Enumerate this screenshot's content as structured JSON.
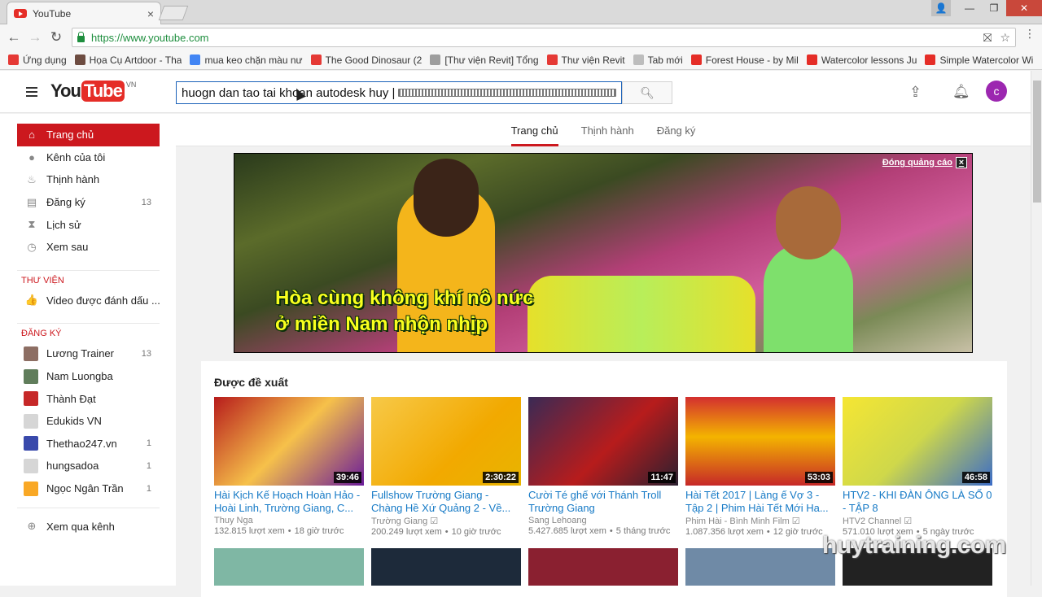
{
  "browser": {
    "tab_title": "YouTube",
    "tab_close": "×",
    "url": "https://www.youtube.com",
    "bookmarks": [
      {
        "label": "Ứng dụng",
        "color": "#e53935"
      },
      {
        "label": "Họa Cụ Artdoor - Tha",
        "color": "#6d4c41"
      },
      {
        "label": "mua keo chặn màu nư",
        "color": "#4285f4"
      },
      {
        "label": "The Good Dinosaur (2",
        "color": "#e53935"
      },
      {
        "label": "[Thư viện Revit] Tổng",
        "color": "#9e9e9e"
      },
      {
        "label": "Thư viện Revit",
        "color": "#e53935"
      },
      {
        "label": "Tab mới",
        "color": "#bdbdbd"
      },
      {
        "label": "Forest House - by Mil",
        "color": "#e52d27"
      },
      {
        "label": "Watercolor lessons Ju",
        "color": "#e52d27"
      },
      {
        "label": "Simple Watercolor Wi",
        "color": "#e52d27"
      }
    ]
  },
  "header": {
    "logo_you": "You",
    "logo_tube": "Tube",
    "logo_region": "VN",
    "search_value": "huogn dan tao tai khoan autodesk huy |",
    "avatar_letter": "c"
  },
  "sidebar": {
    "main_items": [
      {
        "label": "Trang chủ",
        "icon": "⌂",
        "active": true
      },
      {
        "label": "Kênh của tôi",
        "icon": "●"
      },
      {
        "label": "Thịnh hành",
        "icon": "♨"
      },
      {
        "label": "Đăng ký",
        "icon": "▤",
        "count": "13"
      },
      {
        "label": "Lịch sử",
        "icon": "⧗"
      },
      {
        "label": "Xem sau",
        "icon": "◷"
      }
    ],
    "library_heading": "THƯ VIỆN",
    "library_items": [
      {
        "label": "Video được đánh dấu ...",
        "icon": "👍"
      }
    ],
    "subs_heading": "ĐĂNG KÝ",
    "subscriptions": [
      {
        "label": "Lương Trainer",
        "count": "13",
        "color": "#8d6e63"
      },
      {
        "label": "Nam Luongba",
        "count": "",
        "color": "#607d5b"
      },
      {
        "label": "Thành Đạt",
        "count": "",
        "color": "#c62828"
      },
      {
        "label": "Edukids VN",
        "count": "",
        "color": "#d6d6d6"
      },
      {
        "label": "Thethao247.vn",
        "count": "1",
        "color": "#3949ab"
      },
      {
        "label": "hungsadoa",
        "count": "1",
        "color": "#d6d6d6"
      },
      {
        "label": "Ngọc Ngân Trần",
        "count": "1",
        "color": "#f9a825"
      }
    ],
    "browse_channels": "Xem qua kênh"
  },
  "tabs": [
    "Trang chủ",
    "Thịnh hành",
    "Đăng ký"
  ],
  "ad": {
    "caption_line1": "Hòa cùng không khí nô nức",
    "caption_line2": "ở miền Nam nhộn nhịp",
    "close_label": "Đóng quảng cáo",
    "close_x": "×"
  },
  "recommended": {
    "heading": "Được đề xuất",
    "videos": [
      {
        "title": "Hài Kịch Kế Hoạch Hoàn Hảo - Hoài Linh, Trường Giang, C...",
        "channel": "Thuy Nga",
        "views": "132.815 lượt xem",
        "age": "18 giờ trước",
        "duration": "39:46",
        "bg": "linear-gradient(135deg,#b71c1c,#f6c14a 50%,#6a1b9a)"
      },
      {
        "title": "Fullshow Trường Giang - Chàng Hề Xứ Quảng 2 - Về...",
        "channel": "Trường Giang ☑",
        "views": "200.249 lượt xem",
        "age": "10 giờ trước",
        "duration": "2:30:22",
        "bg": "linear-gradient(135deg,#f7c948,#f2a900 60%,#e8b400)"
      },
      {
        "title": "Cười Té ghế với Thánh Troll Trường Giang",
        "channel": "Sang Lehoang",
        "views": "5.427.685 lượt xem",
        "age": "5 tháng trước",
        "duration": "11:47",
        "bg": "linear-gradient(135deg,#3a2a55,#b71c1c 55%,#2b2030)"
      },
      {
        "title": "Hài Tết 2017 | Làng ế Vợ 3 - Tập 2 | Phim Hài Tết Mới Ha...",
        "channel": "Phim Hài - Bình Minh Film ☑",
        "views": "1.087.356 lượt xem",
        "age": "12 giờ trước",
        "duration": "53:03",
        "bg": "linear-gradient(180deg,#d32f2f,#f4b400 45%,#c62828)"
      },
      {
        "title": "HTV2 - KHI ĐÀN ÔNG LÀ SỐ 0 - TẬP 8",
        "channel": "HTV2 Channel ☑",
        "views": "571.010 lượt xem",
        "age": "5 ngày trước",
        "duration": "46:58",
        "bg": "linear-gradient(135deg,#f5e633,#cfd84a 50%,#3b6cc7)"
      }
    ]
  },
  "watermark": "huytraining.com"
}
